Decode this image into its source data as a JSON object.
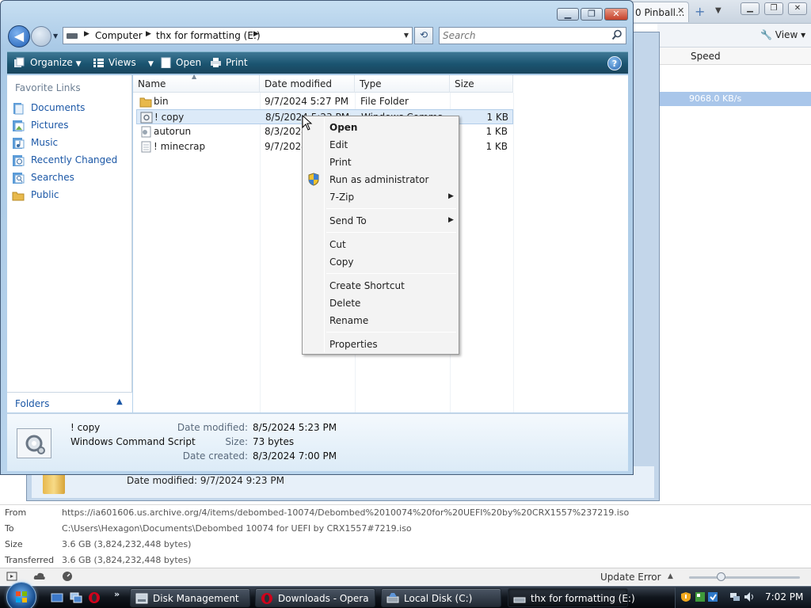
{
  "opera": {
    "tab_title": "0 Pinball...",
    "view_label": "View",
    "speed_header": "Speed",
    "speed_value": "9068.0 KB/s",
    "details": {
      "from_label": "From",
      "from_value": "https://ia601606.us.archive.org/4/items/debombed-10074/Debombed%2010074%20for%20UEFI%20by%20CRX1557%237219.iso",
      "to_label": "To",
      "to_value": "C:\\Users\\Hexagon\\Documents\\Debombed 10074 for UEFI by CRX1557#7219.iso",
      "size_label": "Size",
      "size_value": "3.6 GB (3,824,232,448 bytes)",
      "transferred_label": "Transferred",
      "transferred_value": "3.6 GB (3,824,232,448 bytes)"
    },
    "status": {
      "update_error": "Update Error"
    }
  },
  "background_window": {
    "date_modified_text": "Date modified: 9/7/2024 9:23 PM"
  },
  "explorer": {
    "address": {
      "crumbs": [
        "Computer",
        "thx for formatting (E:)"
      ]
    },
    "search": {
      "placeholder": "Search"
    },
    "toolbar": {
      "organize": "Organize",
      "views": "Views",
      "open": "Open",
      "print": "Print"
    },
    "nav": {
      "header": "Favorite Links",
      "items": [
        {
          "label": "Documents",
          "icon": "documents-icon"
        },
        {
          "label": "Pictures",
          "icon": "pictures-icon"
        },
        {
          "label": "Music",
          "icon": "music-icon"
        },
        {
          "label": "Recently Changed",
          "icon": "recently-changed-icon"
        },
        {
          "label": "Searches",
          "icon": "searches-icon"
        },
        {
          "label": "Public",
          "icon": "public-folder-icon"
        }
      ],
      "folders_label": "Folders"
    },
    "columns": [
      "Name",
      "Date modified",
      "Type",
      "Size"
    ],
    "files": [
      {
        "name": "bin",
        "date": "9/7/2024 5:27 PM",
        "type": "File Folder",
        "size": "",
        "icon": "folder-icon"
      },
      {
        "name": "! copy",
        "date": "8/5/2024 5:23 PM",
        "type": "Windows Comma...",
        "size": "1 KB",
        "icon": "script-icon",
        "selected": true
      },
      {
        "name": "autorun",
        "date": "8/3/2024",
        "type": "",
        "size": "1 KB",
        "icon": "settings-file-icon"
      },
      {
        "name": "! minecrap",
        "date": "9/7/2024",
        "type": "",
        "size": "1 KB",
        "icon": "text-file-icon"
      }
    ],
    "details_pane": {
      "name": "! copy",
      "kind": "Windows Command Script",
      "modified_label": "Date modified:",
      "modified_value": "8/5/2024 5:23 PM",
      "size_label": "Size:",
      "size_value": "73 bytes",
      "created_label": "Date created:",
      "created_value": "8/3/2024 7:00 PM"
    }
  },
  "context_menu": {
    "items": [
      {
        "label": "Open",
        "bold": true
      },
      {
        "label": "Edit"
      },
      {
        "label": "Print"
      },
      {
        "label": "Run as administrator",
        "icon": "uac-shield-icon"
      },
      {
        "label": "7-Zip",
        "submenu": true
      },
      {
        "label": "Send To",
        "submenu": true
      },
      {
        "label": "Cut"
      },
      {
        "label": "Copy"
      },
      {
        "label": "Create Shortcut"
      },
      {
        "label": "Delete"
      },
      {
        "label": "Rename"
      },
      {
        "label": "Properties"
      }
    ]
  },
  "taskbar": {
    "buttons": [
      {
        "label": "Disk Management",
        "icon": "disk-management-icon"
      },
      {
        "label": "Downloads - Opera",
        "icon": "opera-icon"
      },
      {
        "label": "Local Disk (C:)",
        "icon": "drive-icon"
      },
      {
        "label": "thx for formatting (E:)",
        "icon": "drive-icon",
        "active": true
      }
    ],
    "clock": "7:02 PM",
    "colors": {
      "accent": "#1a5470",
      "selection": "#dceaf8",
      "link": "#1b57a6"
    }
  }
}
